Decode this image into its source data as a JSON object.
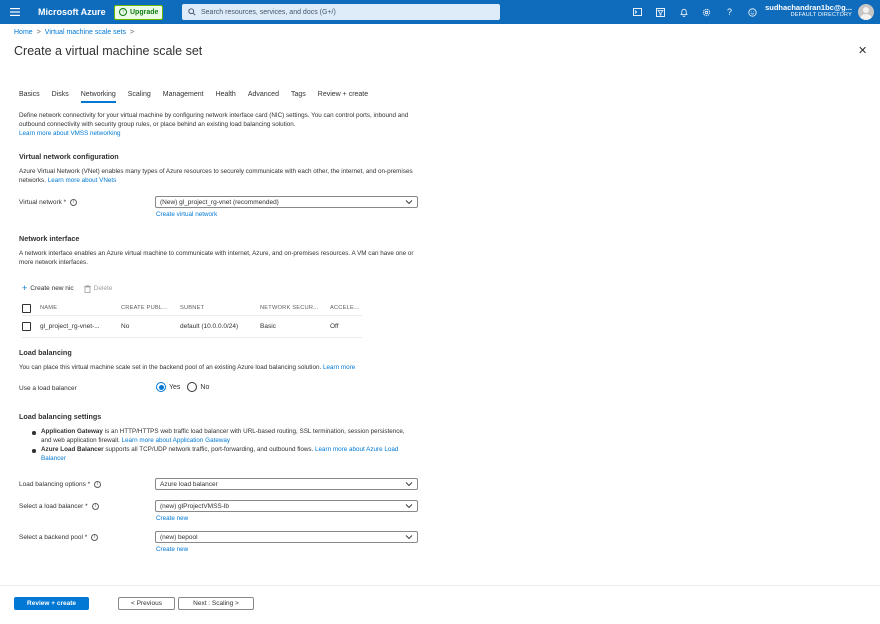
{
  "topbar": {
    "brand": "Microsoft Azure",
    "upgrade_label": "Upgrade",
    "search_placeholder": "Search resources, services, and docs (G+/)",
    "user_name": "sudhachandran1bc@g...",
    "user_directory": "DEFAULT DIRECTORY",
    "icons": [
      "cloud-shell-icon",
      "directory-filter-icon",
      "notifications-icon",
      "settings-icon",
      "help-icon",
      "feedback-icon"
    ]
  },
  "breadcrumb": {
    "home": "Home",
    "sep": ">",
    "parent": "Virtual machine scale sets",
    "sep2": ">"
  },
  "page_title": "Create a virtual machine scale set",
  "tabs": [
    "Basics",
    "Disks",
    "Networking",
    "Scaling",
    "Management",
    "Health",
    "Advanced",
    "Tags",
    "Review + create"
  ],
  "intro": {
    "text": "Define network connectivity for your virtual machine by configuring network interface card (NIC) settings. You can control ports, inbound and outbound connectivity with security group rules, or place behind an existing load balancing solution.",
    "link": "Learn more about VMSS networking"
  },
  "vnet_section": {
    "heading": "Virtual network configuration",
    "text": "Azure Virtual Network (VNet) enables many types of Azure resources to securely communicate with each other, the internet, and on-premises networks.",
    "link": "Learn more about VNets",
    "field_label": "Virtual network *",
    "value": "(New) gl_project_rg-vnet (recommended)",
    "create_link": "Create virtual network"
  },
  "nic_section": {
    "heading": "Network interface",
    "text": "A network interface enables an Azure virtual machine to communicate with internet, Azure, and on-premises resources. A VM can have one or more network interfaces.",
    "create_label": "Create new nic",
    "delete_label": "Delete",
    "columns": [
      "NAME",
      "CREATE PUBL...",
      "SUBNET",
      "NETWORK SECUR...",
      "ACCELERA"
    ],
    "row": [
      "gl_project_rg-vnet-...",
      "No",
      "default (10.0.0.0/24)",
      "Basic",
      "Off"
    ]
  },
  "lb_section": {
    "heading": "Load balancing",
    "text": "You can place this virtual machine scale set in the backend pool of an existing Azure load balancing solution.",
    "link": "Learn more",
    "use_label": "Use a load balancer",
    "yes": "Yes",
    "no": "No",
    "selected": "Yes"
  },
  "lb_settings": {
    "heading": "Load balancing settings",
    "ag_title": "Application Gateway",
    "ag_text": " is an HTTP/HTTPS web traffic load balancer with URL-based routing, SSL termination, session persistence, and web application firewall.",
    "ag_link": "Learn more about Application Gateway",
    "alb_title": "Azure Load Balancer",
    "alb_text": " supports all TCP/UDP network traffic, port-forwarding, and outbound flows.",
    "alb_link": "Learn more about Azure Load Balancer",
    "options_label": "Load balancing options *",
    "options_value": "Azure load balancer",
    "select_lb_label": "Select a load balancer *",
    "select_lb_value": "(new) glProjectVMSS-lb",
    "create_new_1": "Create new",
    "pool_label": "Select a backend pool *",
    "pool_value": "(new) bepool",
    "create_new_2": "Create new"
  },
  "footer": {
    "review": "Review + create",
    "previous": "< Previous",
    "next": "Next : Scaling >"
  },
  "colors": {
    "azure_blue": "#0078d4",
    "topbar": "#0f6cbd"
  }
}
